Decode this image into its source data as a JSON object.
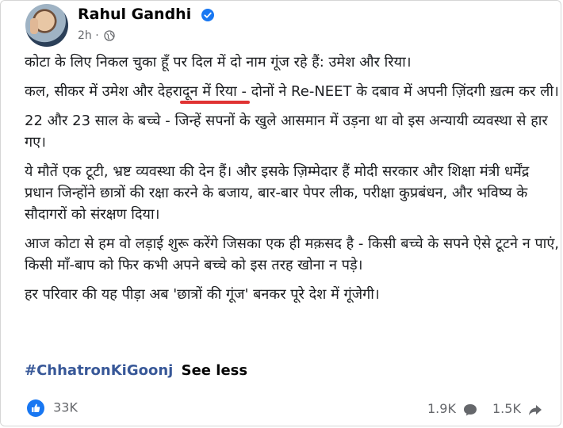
{
  "post": {
    "author": "Rahul Gandhi",
    "time": "2h",
    "separator": "·",
    "paragraphs": [
      "कोटा के लिए निकल चुका हूँ पर दिल में दो नाम गूंज रहे हैं: उमेश और रिया।",
      "कल, सीकर में उमेश और देहरादून में रिया - दोनों ने Re-NEET के दबाव में अपनी ज़िंदगी ख़त्म कर ली।",
      "22 और 23 साल के बच्चे - जिन्हें सपनों के खुले आसमान में उड़ना था वो इस अन्यायी व्यवस्था से हार गए।",
      "ये मौतें एक टूटी, भ्रष्ट व्यवस्था की देन हैं। और इसके ज़िम्मेदार हैं मोदी सरकार और शिक्षा मंत्री धर्मेंद्र प्रधान जिन्होंने छात्रों की रक्षा करने के बजाय, बार-बार पेपर लीक, परीक्षा कुप्रबंधन, और भविष्य के सौदागरों को संरक्षण दिया।",
      "आज कोटा से हम वो लड़ाई शुरू करेंगे जिसका एक ही मक़सद है - किसी बच्चे के सपने ऐसे टूटने न पाएं, किसी माँ-बाप को फिर कभी अपने बच्चे को इस तरह खोना न पड़े।",
      "हर परिवार की यह पीड़ा अब 'छात्रों की गूंज' बनकर पूरे देश में गूंजेगी।"
    ],
    "hashtag": "#ChhatronKiGoonj",
    "see_less": "See less"
  },
  "stats": {
    "likes": "33K",
    "comments": "1.9K",
    "shares": "1.5K"
  },
  "colors": {
    "link": "#385898",
    "verified": "#1877f2",
    "annotation_underline": "#e03232"
  },
  "icons": [
    "verified-badge-icon",
    "globe-icon",
    "like-icon",
    "comment-icon",
    "share-icon"
  ]
}
